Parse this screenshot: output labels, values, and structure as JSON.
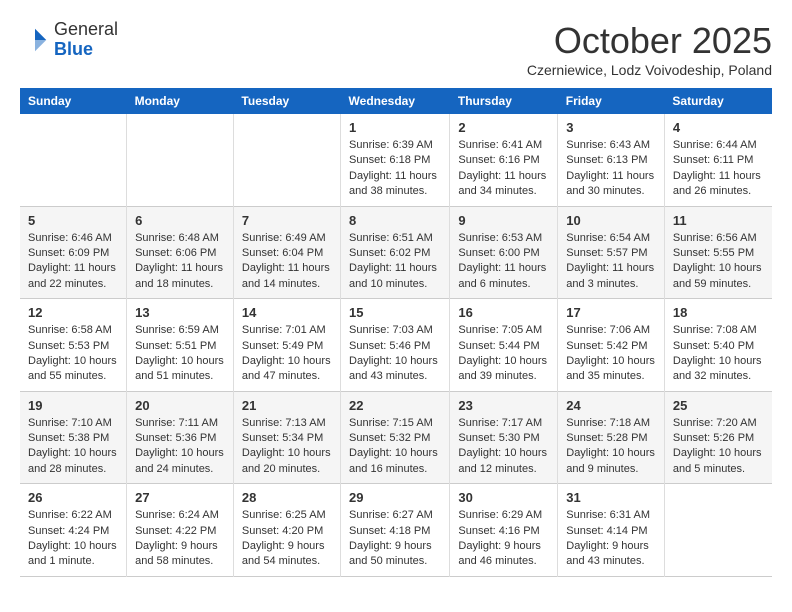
{
  "logo": {
    "general": "General",
    "blue": "Blue"
  },
  "title": "October 2025",
  "location": "Czerniewice, Lodz Voivodeship, Poland",
  "weekdays": [
    "Sunday",
    "Monday",
    "Tuesday",
    "Wednesday",
    "Thursday",
    "Friday",
    "Saturday"
  ],
  "weeks": [
    [
      {
        "day": "",
        "info": ""
      },
      {
        "day": "",
        "info": ""
      },
      {
        "day": "",
        "info": ""
      },
      {
        "day": "1",
        "info": "Sunrise: 6:39 AM\nSunset: 6:18 PM\nDaylight: 11 hours\nand 38 minutes."
      },
      {
        "day": "2",
        "info": "Sunrise: 6:41 AM\nSunset: 6:16 PM\nDaylight: 11 hours\nand 34 minutes."
      },
      {
        "day": "3",
        "info": "Sunrise: 6:43 AM\nSunset: 6:13 PM\nDaylight: 11 hours\nand 30 minutes."
      },
      {
        "day": "4",
        "info": "Sunrise: 6:44 AM\nSunset: 6:11 PM\nDaylight: 11 hours\nand 26 minutes."
      }
    ],
    [
      {
        "day": "5",
        "info": "Sunrise: 6:46 AM\nSunset: 6:09 PM\nDaylight: 11 hours\nand 22 minutes."
      },
      {
        "day": "6",
        "info": "Sunrise: 6:48 AM\nSunset: 6:06 PM\nDaylight: 11 hours\nand 18 minutes."
      },
      {
        "day": "7",
        "info": "Sunrise: 6:49 AM\nSunset: 6:04 PM\nDaylight: 11 hours\nand 14 minutes."
      },
      {
        "day": "8",
        "info": "Sunrise: 6:51 AM\nSunset: 6:02 PM\nDaylight: 11 hours\nand 10 minutes."
      },
      {
        "day": "9",
        "info": "Sunrise: 6:53 AM\nSunset: 6:00 PM\nDaylight: 11 hours\nand 6 minutes."
      },
      {
        "day": "10",
        "info": "Sunrise: 6:54 AM\nSunset: 5:57 PM\nDaylight: 11 hours\nand 3 minutes."
      },
      {
        "day": "11",
        "info": "Sunrise: 6:56 AM\nSunset: 5:55 PM\nDaylight: 10 hours\nand 59 minutes."
      }
    ],
    [
      {
        "day": "12",
        "info": "Sunrise: 6:58 AM\nSunset: 5:53 PM\nDaylight: 10 hours\nand 55 minutes."
      },
      {
        "day": "13",
        "info": "Sunrise: 6:59 AM\nSunset: 5:51 PM\nDaylight: 10 hours\nand 51 minutes."
      },
      {
        "day": "14",
        "info": "Sunrise: 7:01 AM\nSunset: 5:49 PM\nDaylight: 10 hours\nand 47 minutes."
      },
      {
        "day": "15",
        "info": "Sunrise: 7:03 AM\nSunset: 5:46 PM\nDaylight: 10 hours\nand 43 minutes."
      },
      {
        "day": "16",
        "info": "Sunrise: 7:05 AM\nSunset: 5:44 PM\nDaylight: 10 hours\nand 39 minutes."
      },
      {
        "day": "17",
        "info": "Sunrise: 7:06 AM\nSunset: 5:42 PM\nDaylight: 10 hours\nand 35 minutes."
      },
      {
        "day": "18",
        "info": "Sunrise: 7:08 AM\nSunset: 5:40 PM\nDaylight: 10 hours\nand 32 minutes."
      }
    ],
    [
      {
        "day": "19",
        "info": "Sunrise: 7:10 AM\nSunset: 5:38 PM\nDaylight: 10 hours\nand 28 minutes."
      },
      {
        "day": "20",
        "info": "Sunrise: 7:11 AM\nSunset: 5:36 PM\nDaylight: 10 hours\nand 24 minutes."
      },
      {
        "day": "21",
        "info": "Sunrise: 7:13 AM\nSunset: 5:34 PM\nDaylight: 10 hours\nand 20 minutes."
      },
      {
        "day": "22",
        "info": "Sunrise: 7:15 AM\nSunset: 5:32 PM\nDaylight: 10 hours\nand 16 minutes."
      },
      {
        "day": "23",
        "info": "Sunrise: 7:17 AM\nSunset: 5:30 PM\nDaylight: 10 hours\nand 12 minutes."
      },
      {
        "day": "24",
        "info": "Sunrise: 7:18 AM\nSunset: 5:28 PM\nDaylight: 10 hours\nand 9 minutes."
      },
      {
        "day": "25",
        "info": "Sunrise: 7:20 AM\nSunset: 5:26 PM\nDaylight: 10 hours\nand 5 minutes."
      }
    ],
    [
      {
        "day": "26",
        "info": "Sunrise: 6:22 AM\nSunset: 4:24 PM\nDaylight: 10 hours\nand 1 minute."
      },
      {
        "day": "27",
        "info": "Sunrise: 6:24 AM\nSunset: 4:22 PM\nDaylight: 9 hours\nand 58 minutes."
      },
      {
        "day": "28",
        "info": "Sunrise: 6:25 AM\nSunset: 4:20 PM\nDaylight: 9 hours\nand 54 minutes."
      },
      {
        "day": "29",
        "info": "Sunrise: 6:27 AM\nSunset: 4:18 PM\nDaylight: 9 hours\nand 50 minutes."
      },
      {
        "day": "30",
        "info": "Sunrise: 6:29 AM\nSunset: 4:16 PM\nDaylight: 9 hours\nand 46 minutes."
      },
      {
        "day": "31",
        "info": "Sunrise: 6:31 AM\nSunset: 4:14 PM\nDaylight: 9 hours\nand 43 minutes."
      },
      {
        "day": "",
        "info": ""
      }
    ]
  ]
}
